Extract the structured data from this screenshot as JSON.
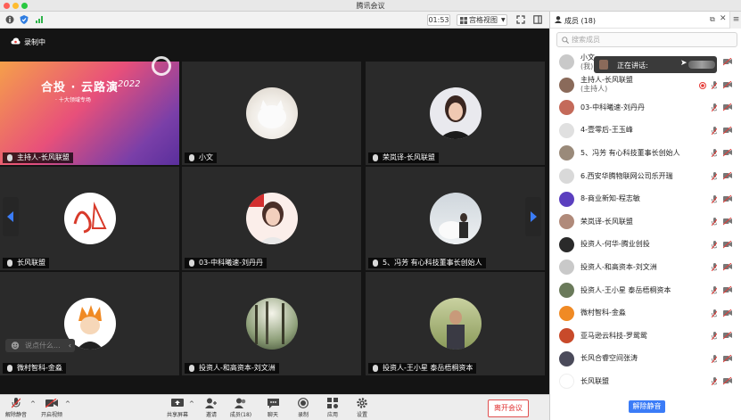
{
  "window": {
    "title": "腾讯会议"
  },
  "toolbar": {
    "timer": "01:53",
    "view_label": "宫格视图"
  },
  "recording": {
    "label": "录制中"
  },
  "banner": {
    "title_cn": "合投 · 云路演",
    "year": "2022",
    "subtitle": "· 十大领域专场"
  },
  "tiles": [
    {
      "name": "主持人-长风联盟"
    },
    {
      "name": "小文"
    },
    {
      "name": "荣岚译-长风联盟"
    },
    {
      "name": "长风联盟"
    },
    {
      "name": "03-中科曦速-刘丹丹"
    },
    {
      "name": "5、冯芳 有心科技董事长创始人"
    },
    {
      "name": "微村智科-金淼"
    },
    {
      "name": "投资人-和高资本-刘文洲"
    },
    {
      "name": "投资人-王小星  泰岳梧桐资本"
    }
  ],
  "chat": {
    "placeholder": "说点什么..."
  },
  "bottombar": {
    "mute": "解除静音",
    "video": "开启视频",
    "share": "共享屏幕",
    "invite": "邀请",
    "members": "成员(18)",
    "chat": "聊天",
    "record": "录制",
    "apps": "应用",
    "settings": "设置",
    "leave": "离开会议"
  },
  "panel": {
    "title": "成员 (18)",
    "search_placeholder": "搜索成员",
    "speaking_label": "正在讲话:",
    "unmute_all": "解除静音",
    "members": [
      {
        "name": "小文",
        "sub": "(我)"
      },
      {
        "name": "主持人-长风联盟",
        "sub": "(主持人)"
      },
      {
        "name": "03-中科曦速-刘丹丹",
        "sub": ""
      },
      {
        "name": "4-壹零后-王玉峰",
        "sub": ""
      },
      {
        "name": "5、冯芳 有心科技董事长创始人",
        "sub": ""
      },
      {
        "name": "6.西安华腾物联网公司乐开瑞",
        "sub": ""
      },
      {
        "name": "8-商业新知-程志敏",
        "sub": ""
      },
      {
        "name": "荣岚译-长风联盟",
        "sub": ""
      },
      {
        "name": "投资人-何华-腾业创投",
        "sub": ""
      },
      {
        "name": "投资人-和高资本-刘文洲",
        "sub": ""
      },
      {
        "name": "投资人-王小星  泰岳梧桐资本",
        "sub": ""
      },
      {
        "name": "微村智科-金淼",
        "sub": ""
      },
      {
        "name": "亚马逊云科技-罗鸳鸳",
        "sub": ""
      },
      {
        "name": "长风合睿空间张涛",
        "sub": ""
      },
      {
        "name": "长风联盟",
        "sub": ""
      }
    ]
  },
  "colors": {
    "accent": "#3b7cf7",
    "leave": "#e03030",
    "rec": "#e53935"
  }
}
